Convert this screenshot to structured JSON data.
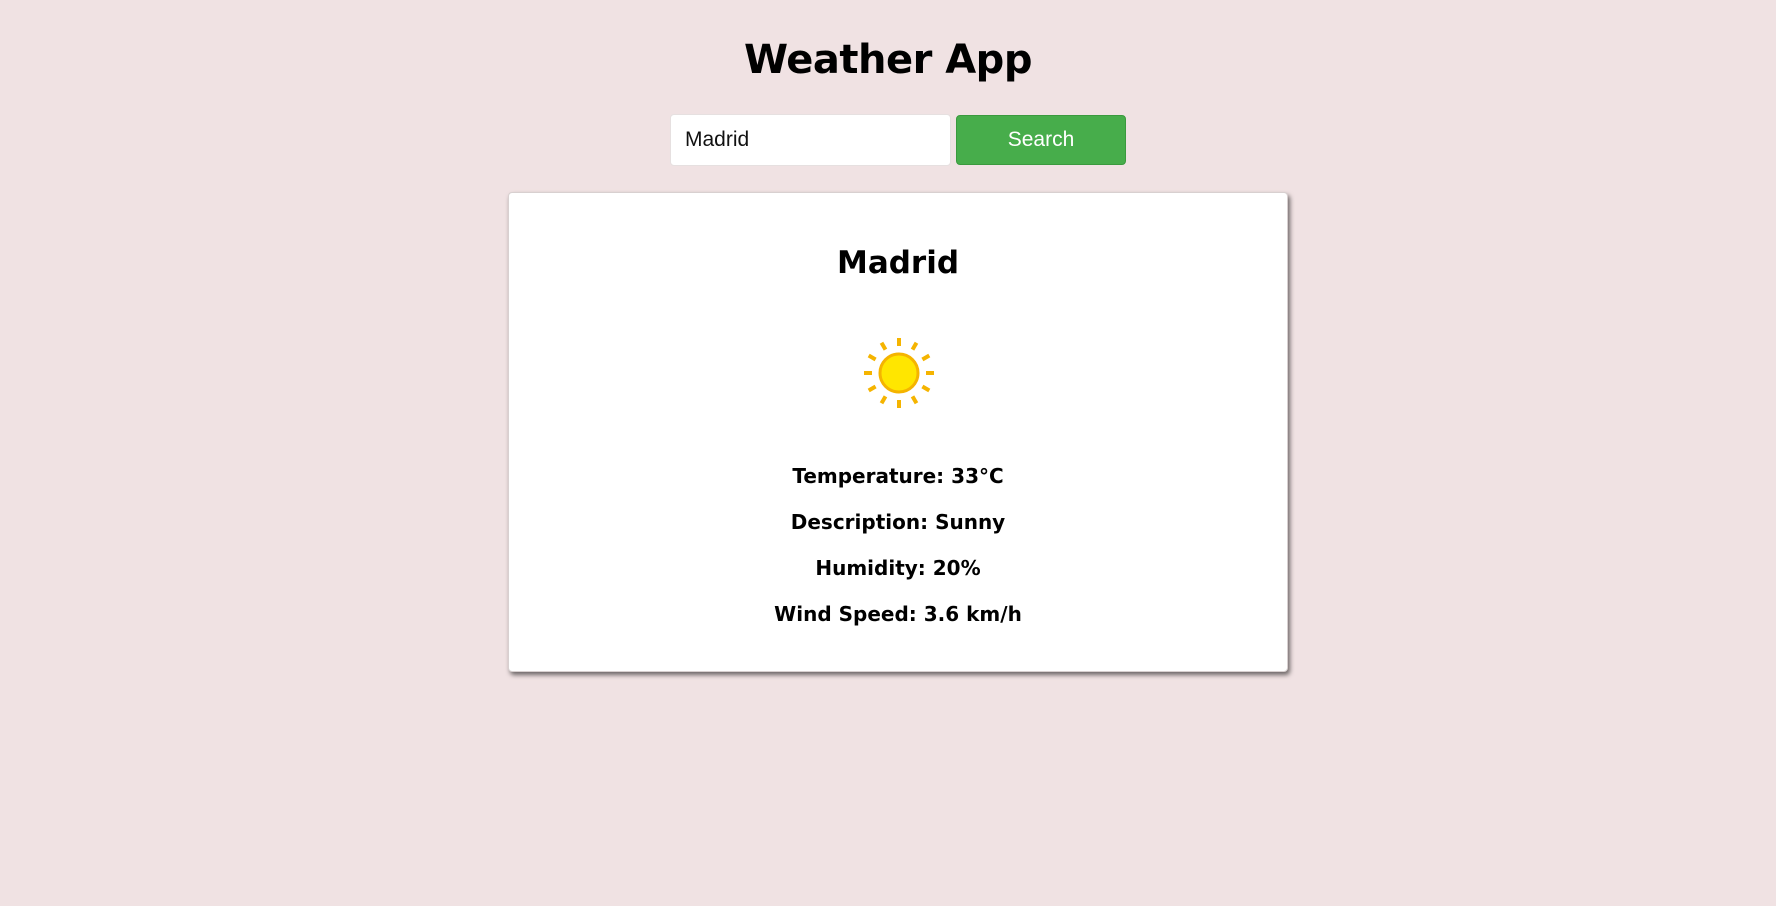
{
  "app": {
    "title": "Weather App"
  },
  "search": {
    "input_value": "Madrid",
    "button_label": "Search"
  },
  "weather": {
    "city": "Madrid",
    "icon": "sun-icon",
    "temperature_text": "Temperature: 33°C",
    "description_text": "Description: Sunny",
    "humidity_text": "Humidity: 20%",
    "wind_speed_text": "Wind Speed: 3.6 km/h"
  },
  "colors": {
    "page_background": "#f0e2e3",
    "search_button": "#47ad4b",
    "sun_core": "#ffe600",
    "sun_rays": "#f5b400"
  }
}
